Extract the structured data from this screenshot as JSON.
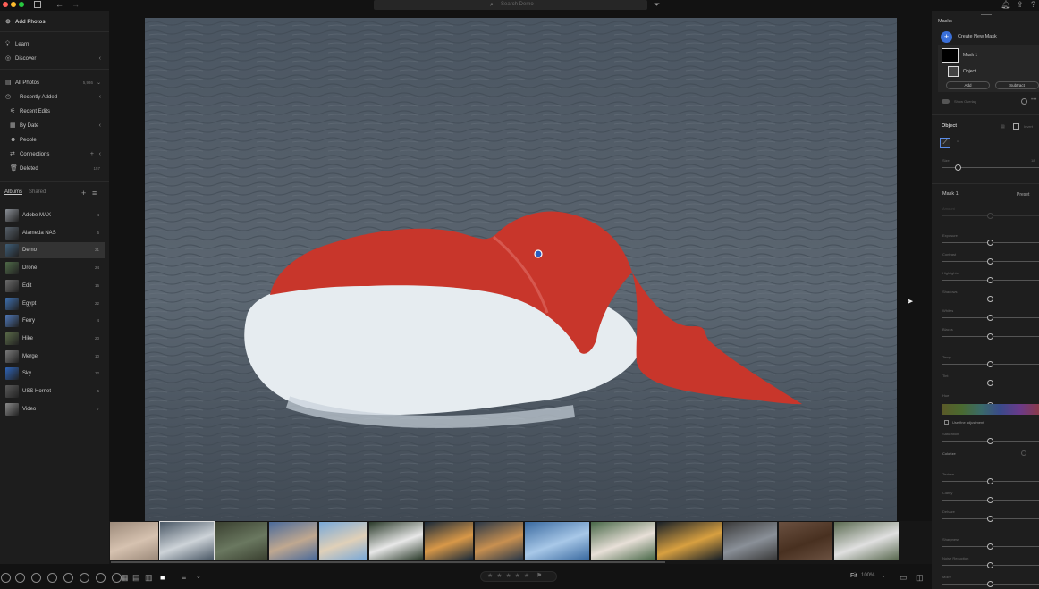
{
  "top": {
    "search_placeholder": "Search Demo"
  },
  "sidebar": {
    "add_photos": "Add Photos",
    "learn": "Learn",
    "discover": "Discover",
    "all_photos": "All Photos",
    "all_photos_count": "5,936",
    "recently_added": "Recently Added",
    "recent_edits": "Recent Edits",
    "by_date": "By Date",
    "people": "People",
    "connections": "Connections",
    "deleted": "Deleted",
    "deleted_count": "157",
    "tab_albums": "Albums",
    "tab_shared": "Shared",
    "albums": [
      {
        "name": "Adobe MAX",
        "count": "4",
        "color": "#8a8f96"
      },
      {
        "name": "Alameda NAS",
        "count": "6",
        "color": "#56606a"
      },
      {
        "name": "Demo",
        "count": "21",
        "color": "#3f5e78"
      },
      {
        "name": "Drone",
        "count": "24",
        "color": "#4f6a48"
      },
      {
        "name": "Edit",
        "count": "16",
        "color": "#6c6c6c"
      },
      {
        "name": "Egypt",
        "count": "22",
        "color": "#3e70b0"
      },
      {
        "name": "Ferry",
        "count": "4",
        "color": "#4f78b8"
      },
      {
        "name": "Hike",
        "count": "20",
        "color": "#5a6a48"
      },
      {
        "name": "Merge",
        "count": "10",
        "color": "#7a7a7a"
      },
      {
        "name": "Sky",
        "count": "12",
        "color": "#2e64b8"
      },
      {
        "name": "USS Hornet",
        "count": "6",
        "color": "#5a5a5a"
      },
      {
        "name": "Video",
        "count": "7",
        "color": "#8a8a8a"
      }
    ]
  },
  "filmstrip": {
    "thumbs": [
      {
        "c1": "#9c8a7a",
        "c2": "#d6c2b0"
      },
      {
        "c1": "#4a5866",
        "c2": "#cdd3d8"
      },
      {
        "c1": "#3a4030",
        "c2": "#6a7860"
      },
      {
        "c1": "#4a6a9a",
        "c2": "#c0a890"
      },
      {
        "c1": "#78a8d8",
        "c2": "#e0d0b8"
      },
      {
        "c1": "#2a3a2a",
        "c2": "#e8e8e8"
      },
      {
        "c1": "#1a2a3a",
        "c2": "#d89848"
      },
      {
        "c1": "#2a3848",
        "c2": "#c89050"
      },
      {
        "c1": "#3a6aa0",
        "c2": "#a8c8e8"
      },
      {
        "c1": "#486848",
        "c2": "#e8e0d8"
      },
      {
        "c1": "#182028",
        "c2": "#d8a040"
      },
      {
        "c1": "#3a3a3a",
        "c2": "#8a9098"
      },
      {
        "c1": "#6a5040",
        "c2": "#483020"
      },
      {
        "c1": "#5a6a50",
        "c2": "#e0e0e0"
      }
    ]
  },
  "bottom": {
    "fit": "Fit",
    "zoom": "100%",
    "stars": "★ ★ ★ ★ ★"
  },
  "right": {
    "masks_title": "Masks",
    "create_mask": "Create New Mask",
    "mask1": "Mask 1",
    "object": "Object",
    "add": "Add",
    "subtract": "Subtract",
    "show_overlay": "Show Overlay",
    "object_title": "Object",
    "invert": "Invert",
    "size": "Size",
    "size_value": "18",
    "mask1_title": "Mask 1",
    "preset": "Preset",
    "amount": "Amount",
    "sliders": [
      {
        "label": "Exposure",
        "value": 0
      },
      {
        "label": "Contrast",
        "value": 0
      },
      {
        "label": "Highlights",
        "value": 0
      },
      {
        "label": "Shadows",
        "value": 0
      },
      {
        "label": "Whites",
        "value": 0
      },
      {
        "label": "Blacks",
        "value": 0
      },
      {
        "label": "Temp",
        "value": 0
      },
      {
        "label": "Tint",
        "value": 0
      },
      {
        "label": "Hue",
        "value": 0
      },
      {
        "label": "Saturation",
        "value": 0
      },
      {
        "label": "Texture",
        "value": 0
      },
      {
        "label": "Clarity",
        "value": 0
      },
      {
        "label": "Dehaze",
        "value": 0
      },
      {
        "label": "Sharpness",
        "value": 0
      },
      {
        "label": "Noise Reduction",
        "value": 0
      },
      {
        "label": "Moiré",
        "value": 0
      }
    ],
    "use_fine": "Use fine adjustment",
    "colorize": "Colorize"
  }
}
